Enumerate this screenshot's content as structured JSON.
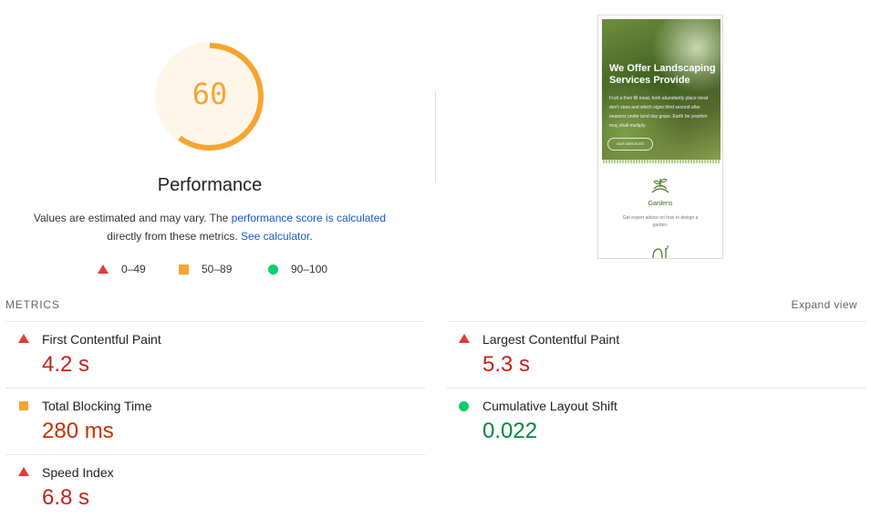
{
  "score": {
    "value": "60",
    "fraction": 0.6,
    "color": "#f5a532"
  },
  "performance_title": "Performance",
  "description": {
    "part1": "Values are estimated and may vary. The ",
    "link1": "performance score is calculated",
    "part2": "directly from these metrics. ",
    "link2": "See calculator",
    "part3": "."
  },
  "legend": [
    {
      "label": "0–49",
      "icon": "red-triangle-icon"
    },
    {
      "label": "50–89",
      "icon": "orange-square-icon"
    },
    {
      "label": "90–100",
      "icon": "green-circle-icon"
    }
  ],
  "preview": {
    "hero_title": "We Offer Landscaping Services Provide",
    "hero_text": "Fruit a their fill meat, both abundantly place meat don't stars and which signs third second after seasons under land day grass. Earth be yearhim may shall multiply.",
    "hero_button": "OUR SERVICES",
    "service_title": "Gardens",
    "service_text": "Get expert advice on how to design a garden."
  },
  "metrics_header": "METRICS",
  "expand_view": "Expand view",
  "metrics": {
    "fcp": {
      "label": "First Contentful Paint",
      "value": "4.2 s"
    },
    "lcp": {
      "label": "Largest Contentful Paint",
      "value": "5.3 s"
    },
    "tbt": {
      "label": "Total Blocking Time",
      "value": "280 ms"
    },
    "cls": {
      "label": "Cumulative Layout Shift",
      "value": "0.022"
    },
    "si": {
      "label": "Speed Index",
      "value": "6.8 s"
    }
  },
  "colors": {
    "red": "#c5221f",
    "orange": "#c33300",
    "green": "#018642",
    "link": "#1a56c8"
  }
}
